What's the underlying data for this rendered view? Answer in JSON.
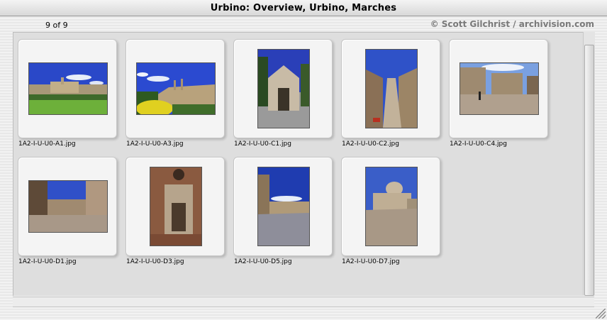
{
  "window": {
    "title": "Urbino: Overview, Urbino, Marches"
  },
  "header": {
    "counter": "9 of 9",
    "copyright": "© Scott Gilchrist / archivision.com"
  },
  "thumbnails": [
    {
      "filename": "1A2-I-U-U0-A1.jpg"
    },
    {
      "filename": "1A2-I-U-U0-A3.jpg"
    },
    {
      "filename": "1A2-I-U-U0-C1.jpg"
    },
    {
      "filename": "1A2-I-U-U0-C2.jpg"
    },
    {
      "filename": "1A2-I-U-U0-C4.jpg"
    },
    {
      "filename": "1A2-I-U-U0-D1.jpg"
    },
    {
      "filename": "1A2-I-U-U0-D3.jpg"
    },
    {
      "filename": "1A2-I-U-U0-D5.jpg"
    },
    {
      "filename": "1A2-I-U-U0-D7.jpg"
    }
  ],
  "colors": {
    "panel": "#dedede",
    "sky": "#2f4fd0",
    "stone": "#b9a58a"
  }
}
